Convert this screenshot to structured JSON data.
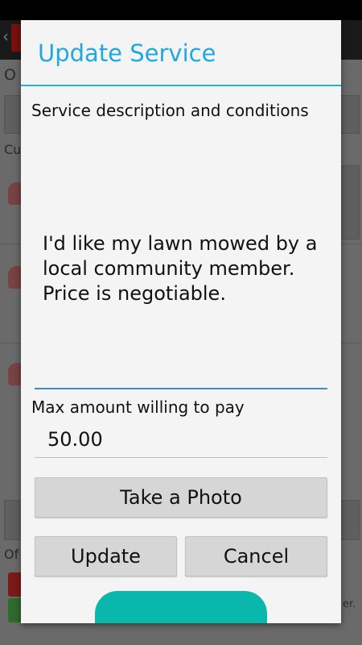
{
  "dialog": {
    "title": "Update Service",
    "description_label": "Service description and conditions",
    "description_value": "I'd like my lawn mowed by a\nlocal community member.\nPrice is negotiable.",
    "amount_label": "Max amount willing to pay",
    "amount_value": "50.00",
    "photo_button": "Take a Photo",
    "update_button": "Update",
    "cancel_button": "Cancel"
  },
  "background": {
    "title_fragment": "O",
    "label_fragment": "Cu",
    "label_fragment_2": "Of",
    "trailing_fragment": "er."
  },
  "colors": {
    "accent": "#1fa9df",
    "teal": "#0ab7ad"
  }
}
